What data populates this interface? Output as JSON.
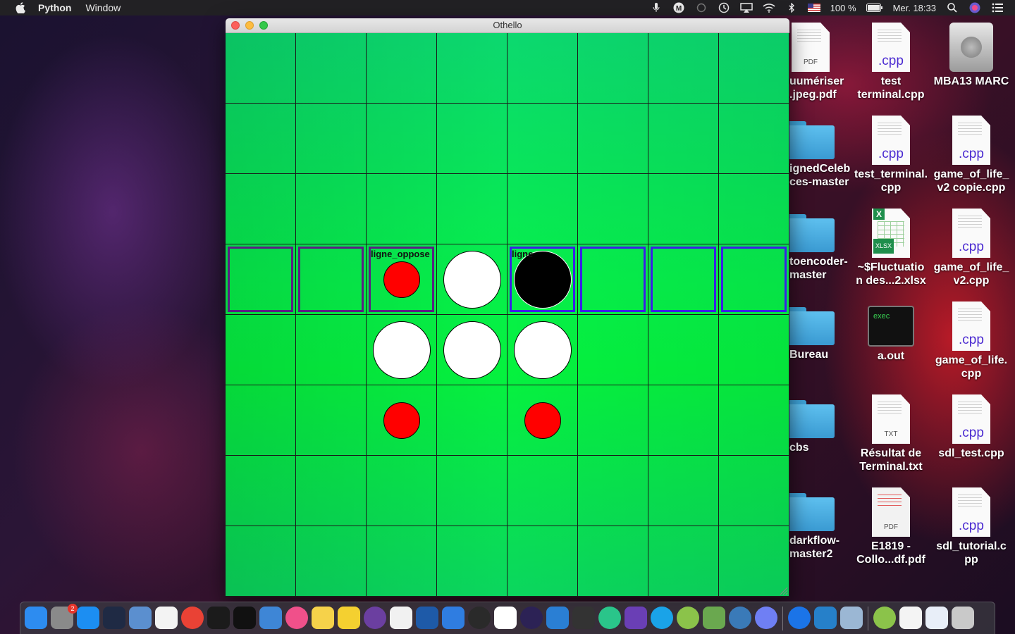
{
  "menubar": {
    "app_name": "Python",
    "menus": [
      "Window"
    ],
    "battery": "100 %",
    "clock": "Mer. 18:33"
  },
  "window": {
    "title": "Othello"
  },
  "board": {
    "size": 8,
    "cells": [
      {
        "row": 3,
        "col": 0,
        "highlight": "purple"
      },
      {
        "row": 3,
        "col": 1,
        "highlight": "purple"
      },
      {
        "row": 3,
        "col": 2,
        "highlight": "purple",
        "label": "ligne_oppose",
        "piece": "red-small"
      },
      {
        "row": 3,
        "col": 3,
        "piece": "white"
      },
      {
        "row": 3,
        "col": 4,
        "highlight": "blue",
        "label": "ligne",
        "piece": "black"
      },
      {
        "row": 3,
        "col": 5,
        "highlight": "blue"
      },
      {
        "row": 3,
        "col": 6,
        "highlight": "blue"
      },
      {
        "row": 3,
        "col": 7,
        "highlight": "blue"
      },
      {
        "row": 4,
        "col": 2,
        "piece": "white"
      },
      {
        "row": 4,
        "col": 3,
        "piece": "white"
      },
      {
        "row": 4,
        "col": 4,
        "piece": "white"
      },
      {
        "row": 5,
        "col": 2,
        "piece": "red-small"
      },
      {
        "row": 5,
        "col": 4,
        "piece": "red-small"
      }
    ],
    "colors": {
      "purple": "#5b1f82",
      "blue": "#3b1fe6",
      "red": "#ff0000",
      "white": "#ffffff",
      "black": "#000000"
    }
  },
  "desktop": {
    "columns": [
      [
        {
          "type": "pdf",
          "label": "uumériser\n.jpeg.pdf",
          "ext": "PDF"
        },
        {
          "type": "folder",
          "label": "ignedCeleb\nces-master"
        },
        {
          "type": "folder",
          "label": "toencoder-\nmaster"
        },
        {
          "type": "folder",
          "label": "Bureau"
        },
        {
          "type": "folder",
          "label": "cbs"
        },
        {
          "type": "folder",
          "label": "darkflow-\nmaster2"
        }
      ],
      [
        {
          "type": "cpp",
          "label": "test\nterminal.cpp",
          "ext": ".cpp"
        },
        {
          "type": "cpp",
          "label": "test_terminal.\ncpp",
          "ext": ".cpp"
        },
        {
          "type": "xlsx",
          "label": "~$Fluctuatio\nn des...2.xlsx",
          "ext": "XLSX"
        },
        {
          "type": "exec",
          "label": "a.out",
          "ext": "exec"
        },
        {
          "type": "txt",
          "label": "Résultat de\nTerminal.txt",
          "ext": "TXT"
        },
        {
          "type": "pdf2",
          "label": "E1819 -\nCollo...df.pdf",
          "ext": "PDF"
        }
      ],
      [
        {
          "type": "hd",
          "label": "MBA13 MARC"
        },
        {
          "type": "cpp",
          "label": "game_of_life_\nv2 copie.cpp",
          "ext": ".cpp"
        },
        {
          "type": "cpp",
          "label": "game_of_life_\nv2.cpp",
          "ext": ".cpp"
        },
        {
          "type": "cpp",
          "label": "game_of_life.\ncpp",
          "ext": ".cpp"
        },
        {
          "type": "cpp",
          "label": "sdl_test.cpp",
          "ext": ".cpp"
        },
        {
          "type": "cpp",
          "label": "sdl_tutorial.c\npp",
          "ext": ".cpp"
        }
      ]
    ]
  },
  "dock": {
    "apps": [
      {
        "name": "finder-icon",
        "color": "#2d8cf0"
      },
      {
        "name": "system-preferences-icon",
        "color": "#8a8a8a",
        "badge": "2"
      },
      {
        "name": "app-store-icon",
        "color": "#1c8ef2"
      },
      {
        "name": "safari-like-icon",
        "color": "#1f2a44"
      },
      {
        "name": "preview-icon",
        "color": "#5b8fcf"
      },
      {
        "name": "calendar-icon",
        "color": "#f3f3f3"
      },
      {
        "name": "chrome-icon",
        "color": "#e94235"
      },
      {
        "name": "activity-monitor-icon",
        "color": "#1b1b1b"
      },
      {
        "name": "terminal-icon",
        "color": "#111111"
      },
      {
        "name": "xcode-icon",
        "color": "#3e86d6"
      },
      {
        "name": "itunes-icon",
        "color": "#f0508a"
      },
      {
        "name": "python-launcher-icon",
        "color": "#f6d24a"
      },
      {
        "name": "cyberduck-icon",
        "color": "#f4d030"
      },
      {
        "name": "github-icon",
        "color": "#6b3fa0"
      },
      {
        "name": "textedit-icon",
        "color": "#f1f1f1"
      },
      {
        "name": "vscode-like-icon",
        "color": "#1e5aa8"
      },
      {
        "name": "maps-icon",
        "color": "#2f7de1"
      },
      {
        "name": "pi-icon",
        "color": "#2a2a2a"
      },
      {
        "name": "reminders-icon",
        "color": "#ffffff"
      },
      {
        "name": "eclipse-icon",
        "color": "#2c2255"
      },
      {
        "name": "sourcetree-icon",
        "color": "#2a7fd4"
      },
      {
        "name": "sublime-icon",
        "color": "#333333"
      },
      {
        "name": "atom-icon",
        "color": "#2ac58a"
      },
      {
        "name": "visual-studio-icon",
        "color": "#6a3fb5"
      },
      {
        "name": "skype-icon",
        "color": "#1aa3e8"
      },
      {
        "name": "android-file-icon",
        "color": "#8bc34a"
      },
      {
        "name": "android-studio-icon",
        "color": "#6aa84f"
      },
      {
        "name": "network-icon",
        "color": "#3a7ab8"
      },
      {
        "name": "discord-icon",
        "color": "#6f7ff4"
      },
      {
        "name": "teamviewer-icon",
        "color": "#1b74e8"
      },
      {
        "name": "vscode-icon",
        "color": "#2680c9"
      },
      {
        "name": "screenshot-icon",
        "color": "#9bb7d4"
      },
      {
        "name": "android-transfer-icon",
        "color": "#8bc34a"
      },
      {
        "name": "document-icon",
        "color": "#f4f4f4"
      },
      {
        "name": "file-icon",
        "color": "#e8eef8"
      },
      {
        "name": "trash-icon",
        "color": "#c9c9c9"
      }
    ]
  }
}
